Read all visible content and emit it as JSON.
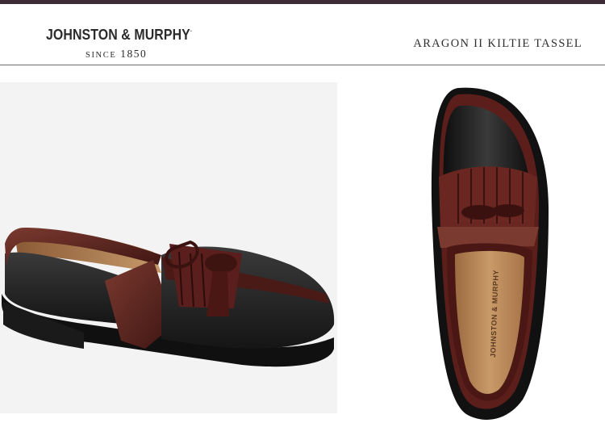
{
  "header": {
    "brand": {
      "name": "JOHNSTON & MURPHY",
      "trademark": ".",
      "since_label": "SINCE",
      "since_year": "1850"
    },
    "product_title": "ARAGON II KILTIE TASSEL"
  },
  "images": {
    "side_view": {
      "icon": "shoe-side-view-image"
    },
    "top_view": {
      "icon": "shoe-top-view-image",
      "insole_text": "JOHNSTON & MURPHY"
    }
  },
  "colors": {
    "top_strip": "#3e2a36",
    "burgundy": "#5a1f1c",
    "black_leather": "#1c1c1c",
    "tan_lining": "#b7895b"
  }
}
